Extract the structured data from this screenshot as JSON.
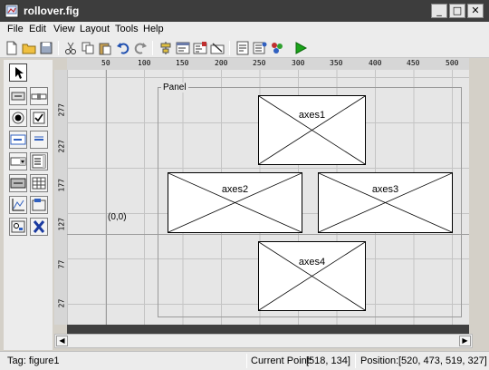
{
  "window": {
    "title": "rollover.fig",
    "minimize": "_",
    "maximize": "□",
    "close": "✕"
  },
  "menu": [
    "File",
    "Edit",
    "View",
    "Layout",
    "Tools",
    "Help"
  ],
  "toolbar": {
    "icons": [
      "new-file-icon",
      "open-folder-icon",
      "save-icon",
      "cut-icon",
      "copy-icon",
      "paste-icon",
      "undo-icon",
      "redo-icon",
      "align-icon",
      "menu-editor-icon",
      "tab-order-icon",
      "toolbar-editor-icon",
      "mfile-editor-icon",
      "property-inspector-icon",
      "object-browser-icon",
      "run-icon"
    ]
  },
  "palette": {
    "tools": [
      "select-tool",
      "pushbutton-tool",
      "slider-tool",
      "radio-button-tool",
      "checkbox-tool",
      "edit-text-tool",
      "static-text-tool",
      "popup-menu-tool",
      "listbox-tool",
      "toggle-button-tool",
      "table-tool",
      "axes-tool",
      "panel-tool",
      "button-group-tool",
      "activex-tool"
    ]
  },
  "rulers": {
    "top": [
      "50",
      "100",
      "150",
      "200",
      "250",
      "300",
      "350",
      "400",
      "450",
      "500"
    ],
    "left": [
      "277",
      "227",
      "177",
      "127",
      "77",
      "27"
    ]
  },
  "canvas": {
    "origin_label": "(0,0)",
    "panel_title": "Panel",
    "axes": [
      "axes1",
      "axes2",
      "axes3",
      "axes4"
    ]
  },
  "status": {
    "tag": "Tag: figure1",
    "current_point_label": "Current Point:",
    "current_point_value": "[518, 134]",
    "position_label": "Position:",
    "position_value": "[520, 473, 519, 327]"
  },
  "colors": {
    "titlebar": "#3d3d3d",
    "canvas_bg": "#e6e6e6",
    "grid": "#c4c4c4",
    "run_green": "#1aa31a"
  }
}
